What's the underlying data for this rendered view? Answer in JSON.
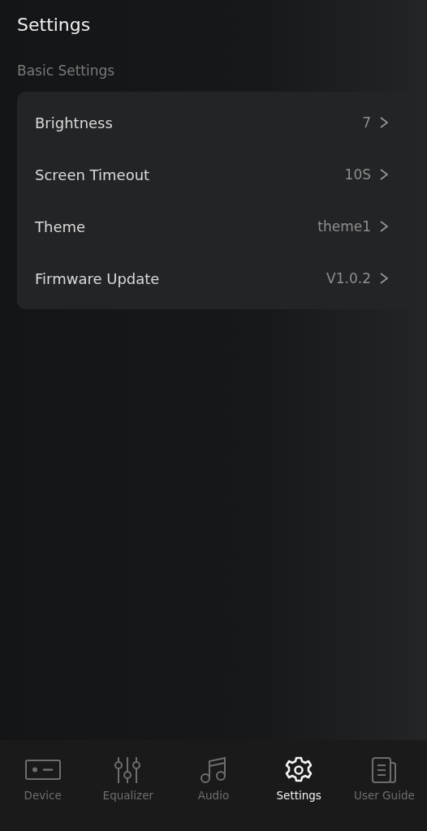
{
  "header": {
    "title": "Settings"
  },
  "section": {
    "title": "Basic Settings",
    "items": [
      {
        "label": "Brightness",
        "value": "7"
      },
      {
        "label": "Screen Timeout",
        "value": "10S"
      },
      {
        "label": "Theme",
        "value": "theme1"
      },
      {
        "label": "Firmware Update",
        "value": "V1.0.2"
      }
    ]
  },
  "tabs": [
    {
      "label": "Device",
      "kind": "device",
      "selected": false
    },
    {
      "label": "Equalizer",
      "kind": "equalizer",
      "selected": false
    },
    {
      "label": "Audio",
      "kind": "audio",
      "selected": false
    },
    {
      "label": "Settings",
      "kind": "settings",
      "selected": true
    },
    {
      "label": "User Guide",
      "kind": "guide",
      "selected": false
    }
  ]
}
